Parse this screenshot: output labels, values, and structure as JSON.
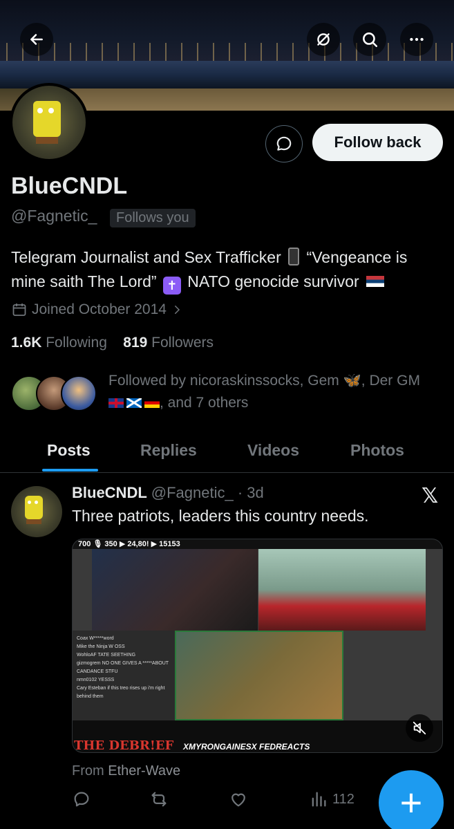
{
  "header": {
    "back_icon": "arrow-left-icon",
    "grok_icon": "grok-icon",
    "search_icon": "search-icon",
    "more_icon": "more-horizontal-icon"
  },
  "profile": {
    "name": "BlueCNDL",
    "handle": "@Fagnetic_",
    "follows_you": "Follows you",
    "follow_back_label": "Follow back",
    "bio_part1": "Telegram Journalist and Sex Trafficker",
    "bio_part2": "“Vengeance is mine saith The Lord”",
    "bio_part3": "NATO genocide survivor",
    "joined": "Joined October 2014",
    "following_count": "1.6K",
    "following_label": "Following",
    "followers_count": "819",
    "followers_label": "Followers",
    "followed_by_prefix": "Followed by nicoraskinssocks, Gem",
    "followed_by_middle": ", Der GM",
    "followed_by_suffix": ", and 7 others"
  },
  "tabs": [
    {
      "label": "Posts",
      "active": true
    },
    {
      "label": "Replies",
      "active": false
    },
    {
      "label": "Videos",
      "active": false
    },
    {
      "label": "Photos",
      "active": false
    }
  ],
  "tweet": {
    "name": "BlueCNDL",
    "handle": "@Fagnetic_",
    "time": "· 3d",
    "text": "Three patriots, leaders this country needs.",
    "media": {
      "topbar": "700 🎙 350 ▶ 24,80! ▶ 15153",
      "chat_lines": [
        "Coax  W*****word",
        "Mike the Ninja  W OSS",
        "WohloAF  TATE SEETHING",
        "gizmogrem  NO ONE GIVES A *****ABOUT CANDANCE STFU",
        "nmn0102  YESSS",
        "Cary Esteban  if this treo rises up i'm right behind them"
      ],
      "overlay_left": "THE DEBR!EF",
      "overlay_right": "XMYRONGAINESX FEDREACTS"
    },
    "source_prefix": "From",
    "source_name": "Ether-Wave",
    "views": "112"
  },
  "fab_label": "+"
}
